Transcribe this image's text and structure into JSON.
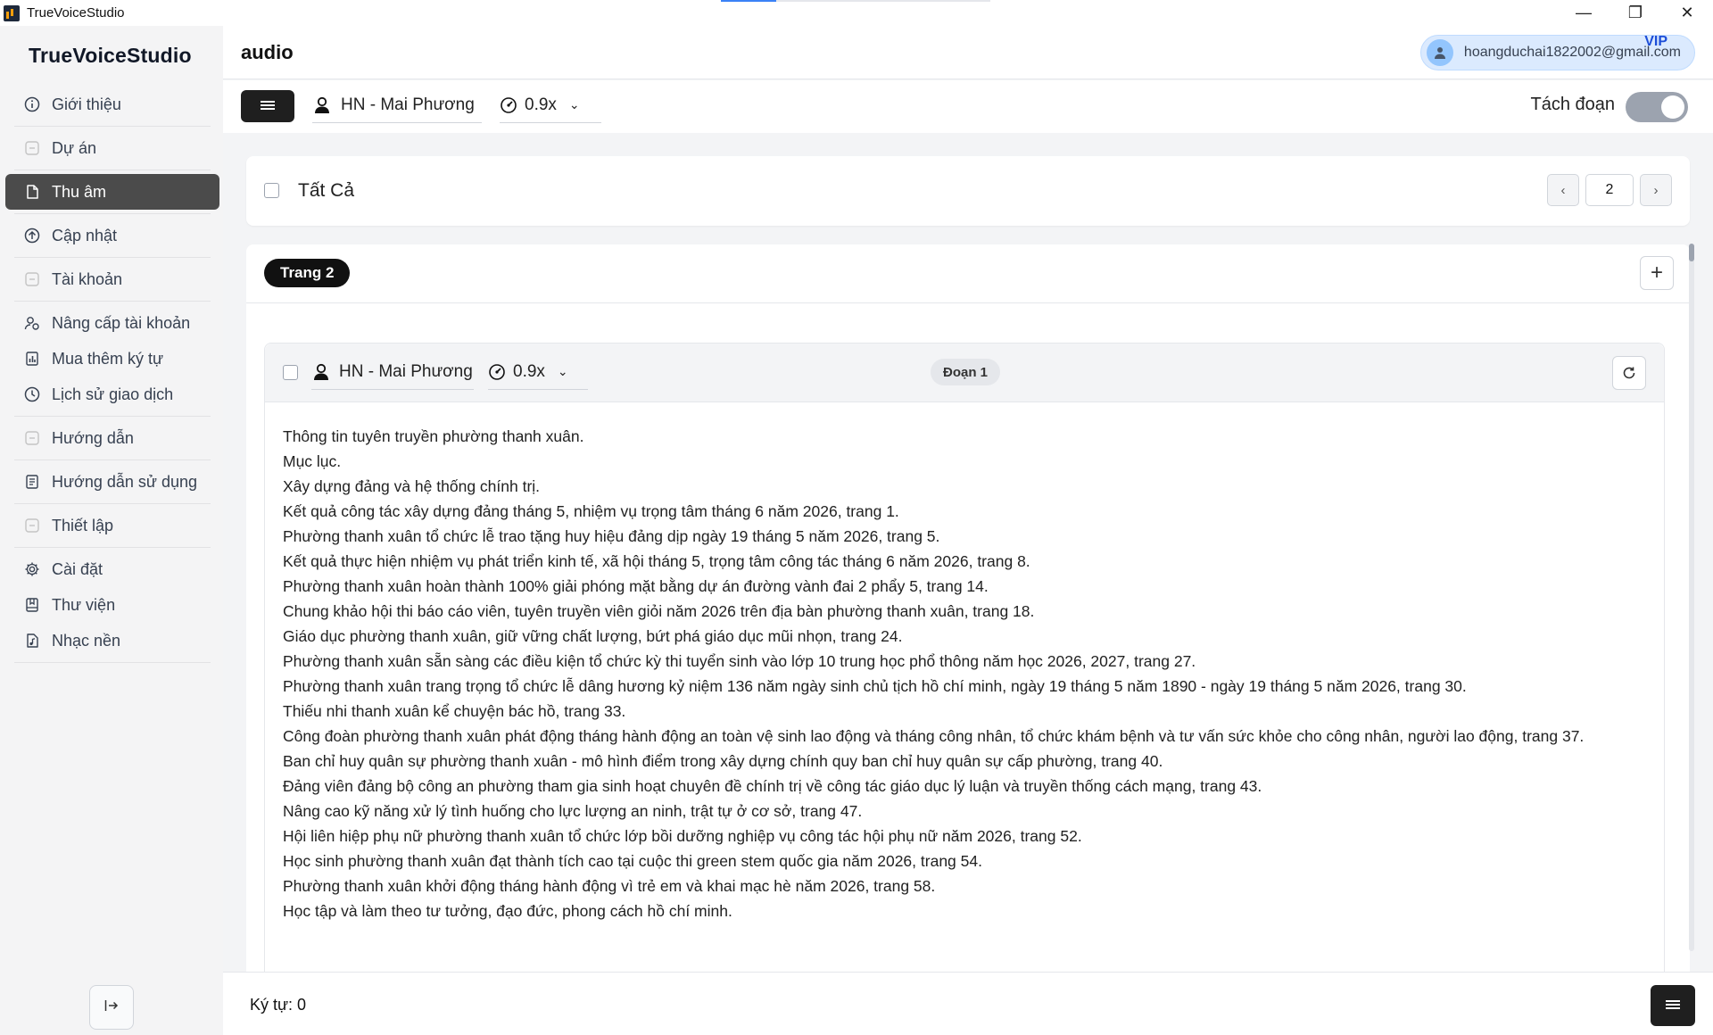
{
  "window": {
    "title": "TrueVoiceStudio",
    "controls": [
      "—",
      "❐",
      "✕"
    ]
  },
  "sidebar": {
    "brand": "TrueVoiceStudio",
    "items": [
      {
        "label": "Giới thiệu",
        "icon": "info-icon"
      },
      {
        "label": "Dự án",
        "icon": "folder-icon"
      },
      {
        "label": "Thu âm",
        "icon": "file-icon",
        "active": true
      },
      {
        "label": "Cập nhật",
        "icon": "upload-icon"
      },
      {
        "label": "Tài khoản",
        "icon": "account-icon"
      },
      {
        "label": "Nâng cấp tài khoản",
        "icon": "user-upgrade-icon"
      },
      {
        "label": "Mua thêm ký tự",
        "icon": "chart-icon"
      },
      {
        "label": "Lịch sử giao dịch",
        "icon": "history-icon"
      },
      {
        "label": "Hướng dẫn",
        "icon": "guide-icon"
      },
      {
        "label": "Hướng dẫn sử dụng",
        "icon": "manual-icon"
      },
      {
        "label": "Thiết lập",
        "icon": "setup-icon"
      },
      {
        "label": "Cài đặt",
        "icon": "gear-icon"
      },
      {
        "label": "Thư viện",
        "icon": "library-icon"
      },
      {
        "label": "Nhạc nền",
        "icon": "music-icon"
      }
    ]
  },
  "header": {
    "title": "audio",
    "user_email": "hoangduchai1822002@gmail.com",
    "badge": "VIP"
  },
  "toolbar": {
    "voice": "HN - Mai Phương",
    "speed": "0.9x",
    "split_label": "Tách đoạn",
    "split_enabled": true
  },
  "select_all": {
    "label": "Tất Cả"
  },
  "pagination": {
    "current": "2",
    "prev": "‹",
    "next": "›"
  },
  "page": {
    "badge": "Trang 2",
    "add": "+",
    "segment": {
      "voice": "HN - Mai Phương",
      "speed": "0.9x",
      "badge": "Đoạn 1",
      "lines": [
        "Thông tin tuyên truyền phường thanh xuân.",
        "Mục lục.",
        "Xây dựng đảng và hệ thống chính trị.",
        "Kết quả công tác xây dựng đảng tháng 5, nhiệm vụ trọng tâm tháng 6 năm 2026, trang 1.",
        "Phường thanh xuân tổ chức lễ trao tặng huy hiệu đảng dịp ngày 19 tháng 5 năm 2026, trang 5.",
        "Kết quả thực hiện nhiệm vụ phát triển kinh tế, xã hội tháng 5, trọng tâm công tác tháng 6 năm 2026, trang 8.",
        "Phường thanh xuân hoàn thành 100% giải phóng mặt bằng dự án đường vành đai 2 phẩy 5, trang 14.",
        "Chung khảo hội thi báo cáo viên, tuyên truyền viên giỏi năm 2026 trên địa bàn phường thanh xuân, trang 18.",
        "Giáo dục phường thanh xuân, giữ vững chất lượng, bứt phá giáo dục mũi nhọn, trang 24.",
        "Phường thanh xuân sẵn sàng các điều kiện tổ chức kỳ thi tuyển sinh vào lớp 10 trung học phổ thông năm học 2026, 2027, trang 27.",
        "Phường thanh xuân trang trọng tổ chức lễ dâng hương kỷ niệm 136 năm ngày sinh chủ tịch hồ chí minh, ngày 19 tháng 5 năm 1890 - ngày 19 tháng 5 năm 2026, trang 30.",
        "Thiếu nhi thanh xuân kể chuyện bác hồ, trang 33.",
        "Công đoàn phường thanh xuân phát động tháng hành động an toàn vệ sinh lao động và tháng công nhân, tổ chức khám bệnh và tư vấn sức khỏe cho công nhân, người lao động, trang 37.",
        "Ban chỉ huy quân sự phường thanh xuân - mô hình điểm trong xây dựng chính quy ban chỉ huy quân sự cấp phường, trang 40.",
        "Đảng viên đảng bộ công an phường tham gia sinh hoạt chuyên đề chính trị về công tác giáo dục lý luận và truyền thống cách mạng, trang 43.",
        "Nâng cao kỹ năng xử lý tình huống cho lực lượng an ninh, trật tự ở cơ sở, trang 47.",
        "Hội liên hiệp phụ nữ phường thanh xuân tổ chức lớp bồi dưỡng nghiệp vụ công tác hội phụ nữ năm 2026, trang 52.",
        "Học sinh phường thanh xuân đạt thành tích cao tại cuộc thi green stem quốc gia năm 2026, trang 54.",
        "Phường thanh xuân khởi động tháng hành động vì trẻ em và khai mạc hè năm 2026, trang 58.",
        "Học tập và làm theo tư tưởng, đạo đức, phong cách hồ chí minh."
      ]
    }
  },
  "footer": {
    "char_count": "Ký tự: 0"
  },
  "colors": {
    "active_nav": "#4b4b4b",
    "accent_vip": "#1d4ed8",
    "dark_button": "#1f1f1f"
  }
}
